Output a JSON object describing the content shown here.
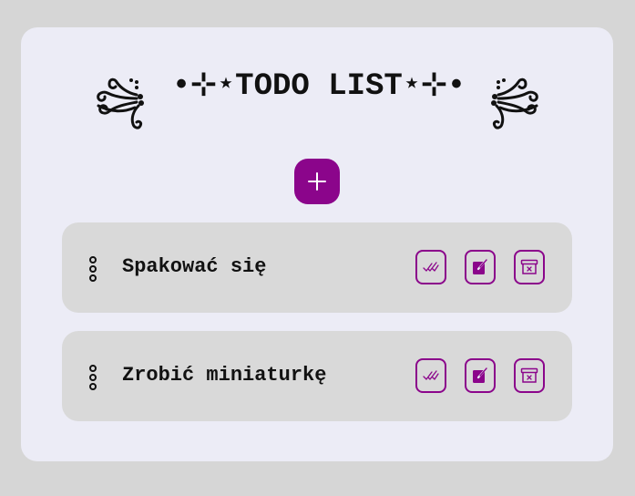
{
  "header": {
    "title": "•⊹⋆TODO LIST⋆⊹•"
  },
  "colors": {
    "accent": "#8b058b",
    "card_background": "#ececf6",
    "page_background": "#d6d6d6",
    "item_background": "#d9d9d9"
  },
  "add_button": {
    "icon": "plus-icon"
  },
  "todos": [
    {
      "text": "Spakować się"
    },
    {
      "text": "Zrobić miniaturkę"
    }
  ],
  "actions": {
    "done_icon": "double-check-icon",
    "edit_icon": "edit-icon",
    "delete_icon": "archive-delete-icon"
  }
}
